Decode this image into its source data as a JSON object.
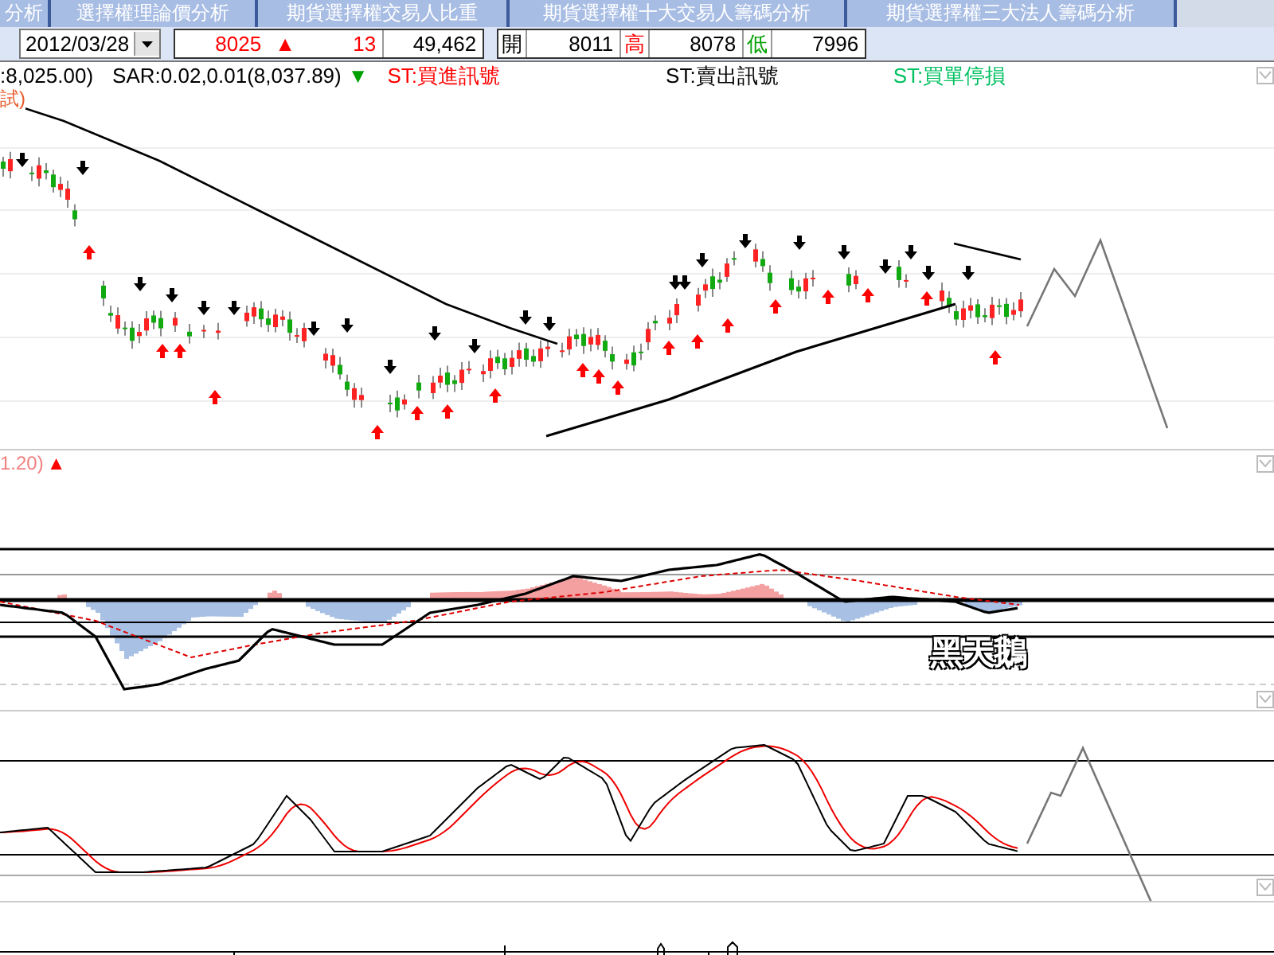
{
  "tabs": [
    {
      "label": "分析"
    },
    {
      "label": "選擇權理論價分析"
    },
    {
      "label": "期貨選擇權交易人比重"
    },
    {
      "label": "期貨選擇權十大交易人籌碼分析"
    },
    {
      "label": "期貨選擇權三大法人籌碼分析"
    }
  ],
  "toolbar": {
    "date": "2012/03/28",
    "price": "8025",
    "change_arrow": "▲",
    "change": "13",
    "volume": "49,462",
    "ohlc": [
      {
        "label": "開",
        "value": "8011",
        "color": "#000000"
      },
      {
        "label": "高",
        "value": "8078",
        "color": "#ff0000"
      },
      {
        "label": "低",
        "value": "7996",
        "color": "#00a000"
      }
    ]
  },
  "legend": [
    {
      "text": ":8,025.00)",
      "color": "#000000"
    },
    {
      "text": "SAR:0.02,0.01(8,037.89)",
      "color": "#000000"
    },
    {
      "text": "▼",
      "color": "#00a000"
    },
    {
      "text": "ST:買進訊號",
      "color": "#ff0000"
    },
    {
      "text": "ST:賣出訊號",
      "color": "#000000"
    },
    {
      "text": "ST:買單停損",
      "color": "#00c060"
    }
  ],
  "price_panel": {
    "label": "試)"
  },
  "macd_panel": {
    "label": "1.20)",
    "marker": "▲",
    "annotation": "黑天鵝"
  }
}
